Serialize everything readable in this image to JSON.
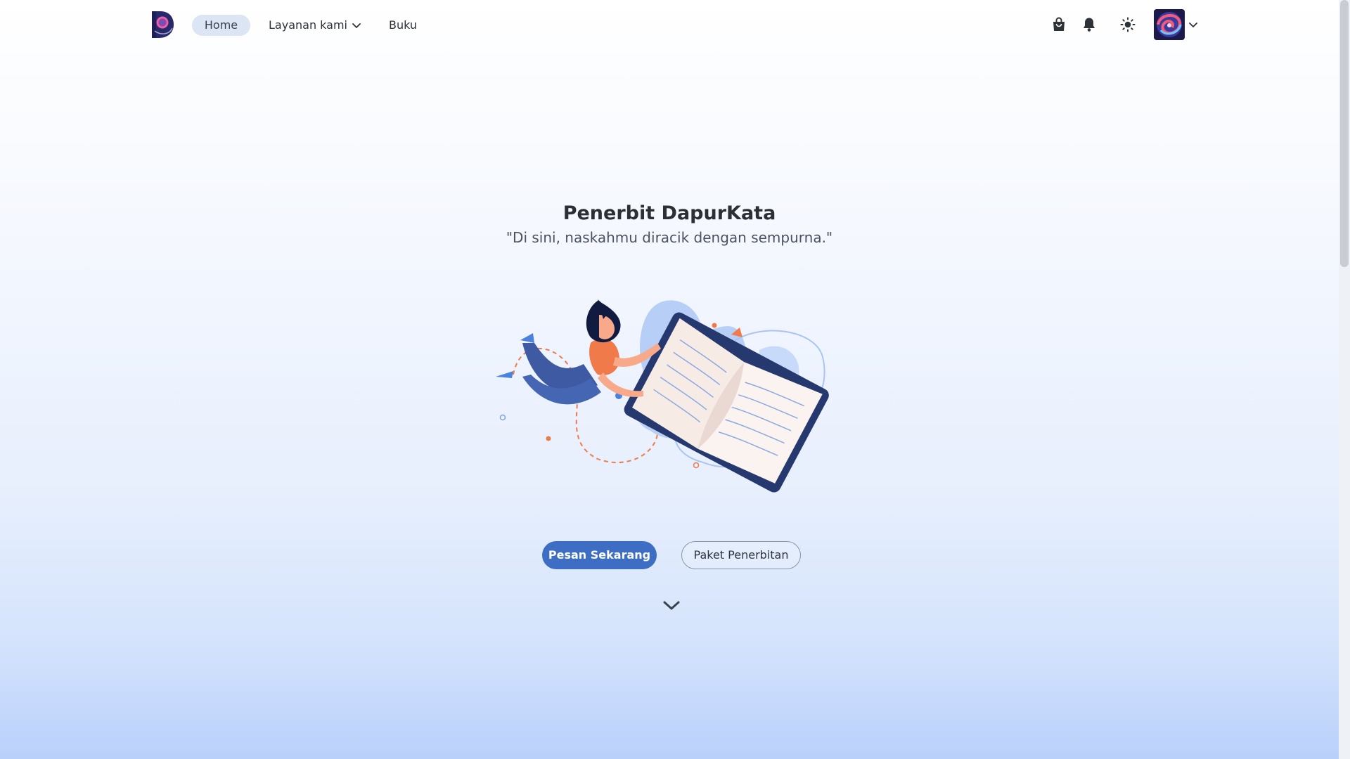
{
  "nav": {
    "home": "Home",
    "layanan": "Layanan kami",
    "buku": "Buku"
  },
  "icons": {
    "logo": "dapurkata-logo",
    "cart": "shopping-bag-icon",
    "bell": "bell-icon",
    "theme": "sun-icon",
    "avatar_menu": "chevron-down-icon",
    "scroll": "chevron-down-icon"
  },
  "hero": {
    "title": "Penerbit DapurKata",
    "subtitle": "\"Di sini, naskahmu diracik dengan sempurna.\"",
    "primary_button": "Pesan Sekarang",
    "secondary_button": "Paket Penerbitan"
  },
  "colors": {
    "accent": "#3d6ec4",
    "nav_active_bg": "#dbe5f4",
    "text_dark": "#2b2f36",
    "illustration_orange": "#f07a4a",
    "illustration_navy": "#26396f"
  }
}
